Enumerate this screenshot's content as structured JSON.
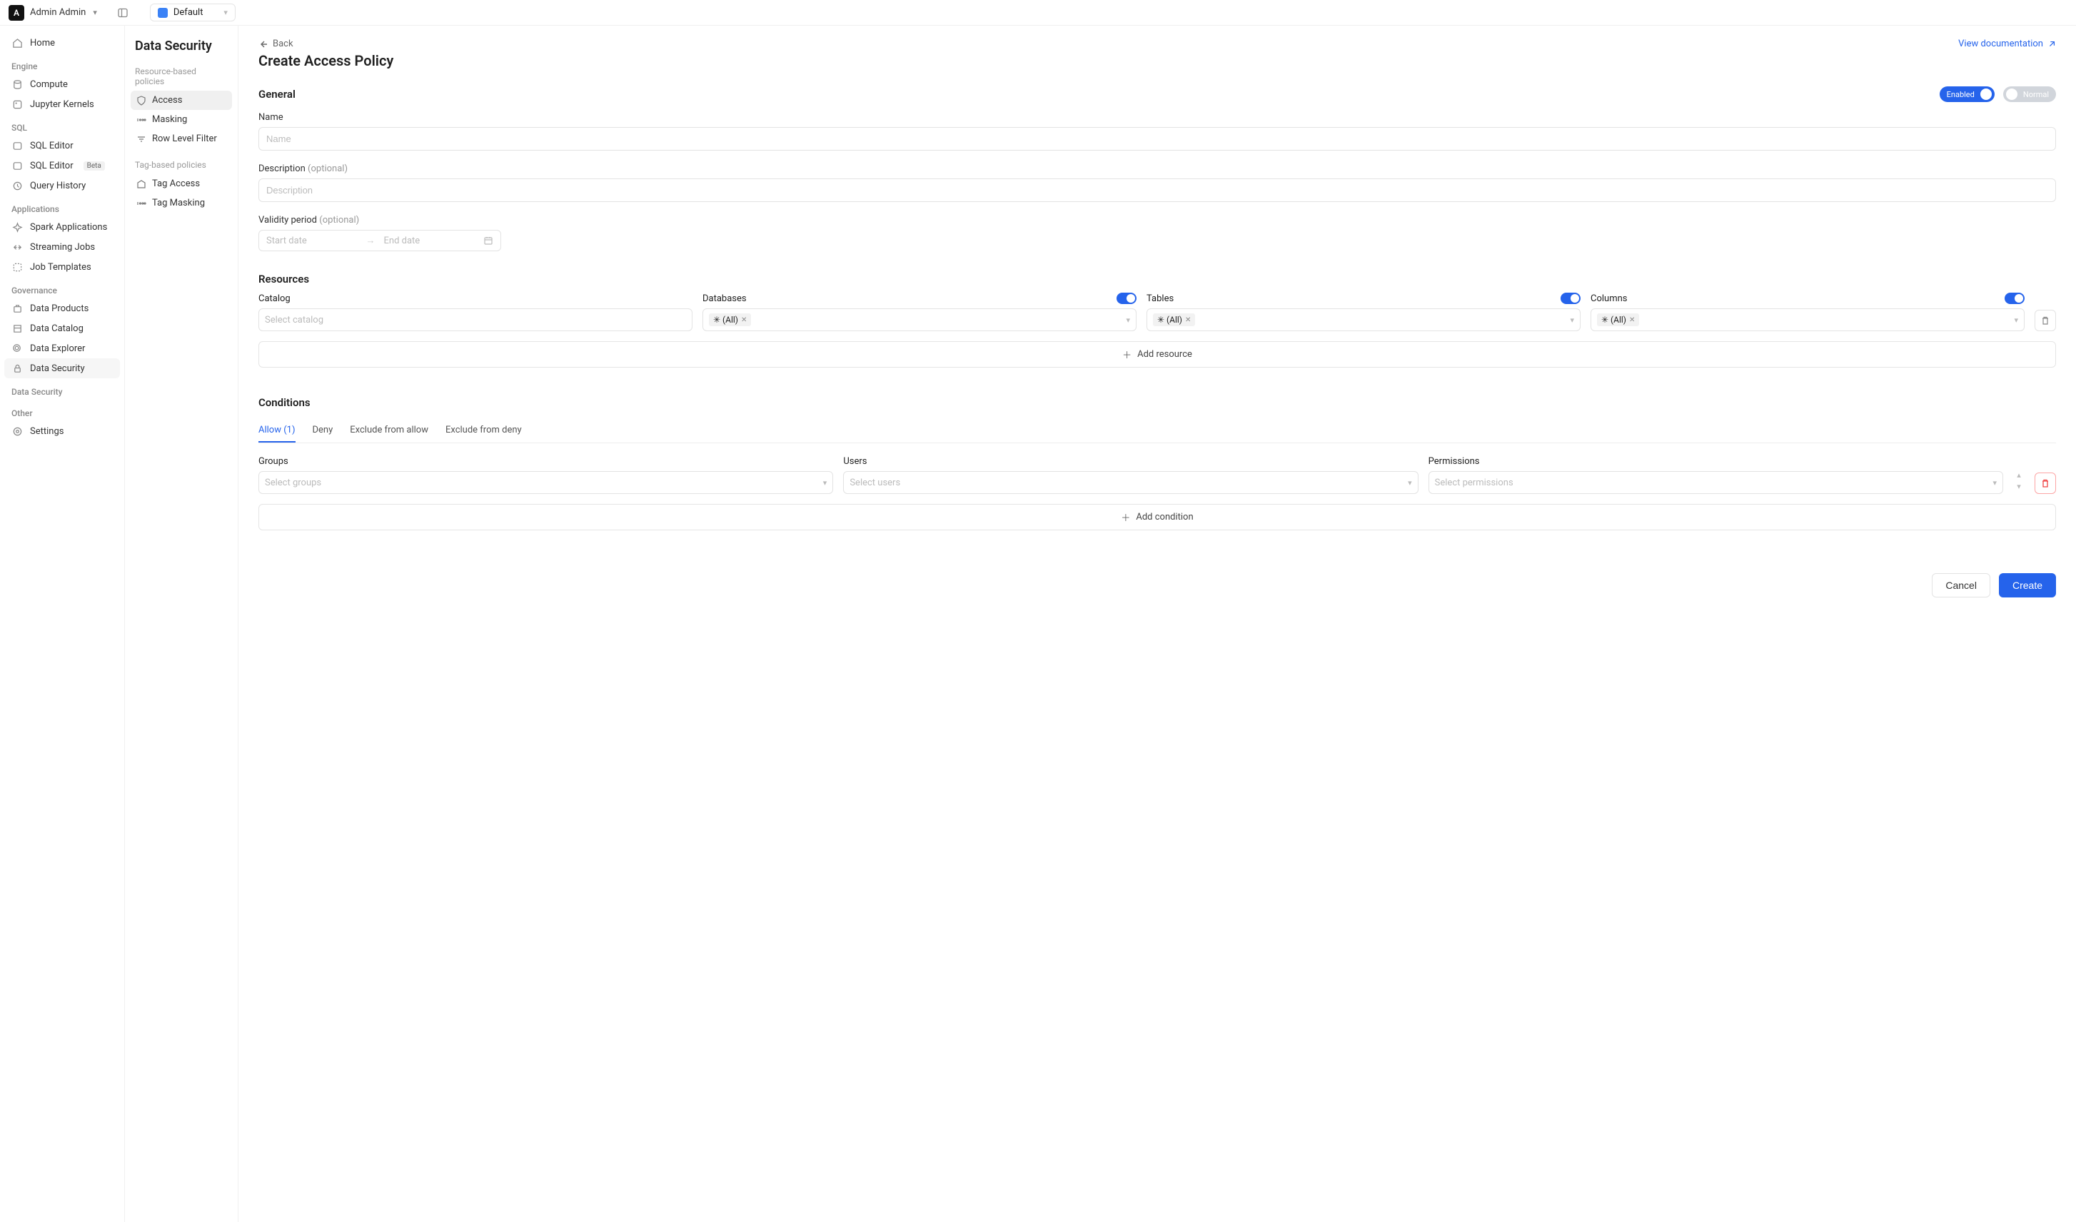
{
  "topbar": {
    "user": "Admin Admin",
    "avatar_letter": "A",
    "workspace": "Default"
  },
  "nav": {
    "home": "Home",
    "engine_group": "Engine",
    "compute": "Compute",
    "jupyter": "Jupyter Kernels",
    "sql_group": "SQL",
    "sql_editor": "SQL Editor",
    "sql_editor_beta": "SQL Editor",
    "beta_badge": "Beta",
    "query_history": "Query History",
    "apps_group": "Applications",
    "spark_apps": "Spark Applications",
    "streaming": "Streaming Jobs",
    "job_templates": "Job Templates",
    "gov_group": "Governance",
    "data_products": "Data Products",
    "data_catalog": "Data Catalog",
    "data_explorer": "Data Explorer",
    "data_security": "Data Security",
    "ds_group": "Data Security",
    "other_group": "Other",
    "settings": "Settings"
  },
  "sub": {
    "title": "Data Security",
    "rb_group": "Resource-based policies",
    "access": "Access",
    "masking": "Masking",
    "row_level": "Row Level Filter",
    "tb_group": "Tag-based policies",
    "tag_access": "Tag Access",
    "tag_masking": "Tag Masking"
  },
  "page": {
    "back": "Back",
    "view_doc": "View documentation",
    "title": "Create Access Policy"
  },
  "general": {
    "heading": "General",
    "enabled_label": "Enabled",
    "normal_label": "Normal",
    "name_label": "Name",
    "name_ph": "Name",
    "desc_label": "Description",
    "optional": "(optional)",
    "desc_ph": "Description",
    "validity_label": "Validity period",
    "start_ph": "Start date",
    "end_ph": "End date"
  },
  "resources": {
    "heading": "Resources",
    "catalog_label": "Catalog",
    "catalog_ph": "Select catalog",
    "databases_label": "Databases",
    "tables_label": "Tables",
    "columns_label": "Columns",
    "all_tag": "✳ (All)",
    "add": "Add resource"
  },
  "conditions": {
    "heading": "Conditions",
    "tabs": {
      "allow": "Allow (1)",
      "deny": "Deny",
      "ex_allow": "Exclude from allow",
      "ex_deny": "Exclude from deny"
    },
    "groups_label": "Groups",
    "groups_ph": "Select groups",
    "users_label": "Users",
    "users_ph": "Select users",
    "perms_label": "Permissions",
    "perms_ph": "Select permissions",
    "add": "Add condition"
  },
  "footer": {
    "cancel": "Cancel",
    "create": "Create"
  }
}
